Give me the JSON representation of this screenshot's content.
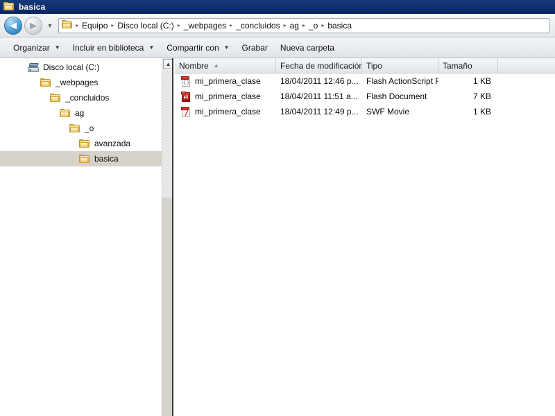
{
  "window": {
    "title": "basica",
    "title_icon": "folder-icon",
    "titlebar_color": "#0c2a66"
  },
  "navbar": {
    "back_icon": "back-arrow-icon",
    "back_glyph": "◀",
    "forward_icon": "forward-arrow-icon",
    "forward_glyph": "▶",
    "history_icon": "chevron-down-icon",
    "history_glyph": "▼",
    "address_icon": "folder-icon",
    "separator_glyph": "▸",
    "breadcrumbs": [
      "Equipo",
      "Disco local (C:)",
      "_webpages",
      "_concluidos",
      "ag",
      "_o",
      "basica"
    ]
  },
  "toolbar": {
    "items": [
      {
        "label": "Organizar",
        "has_caret": true
      },
      {
        "label": "Incluir en biblioteca",
        "has_caret": true
      },
      {
        "label": "Compartir con",
        "has_caret": true
      },
      {
        "label": "Grabar",
        "has_caret": false
      },
      {
        "label": "Nueva carpeta",
        "has_caret": false
      }
    ],
    "caret_glyph": "▼"
  },
  "tree": {
    "scroll_up_glyph": "▲",
    "items": [
      {
        "label": "Disco local (C:)",
        "icon": "hard-drive-icon",
        "indent": 0,
        "selected": false
      },
      {
        "label": "_webpages",
        "icon": "folder-icon",
        "indent": 1,
        "selected": false
      },
      {
        "label": "_concluidos",
        "icon": "folder-icon",
        "indent": 2,
        "selected": false
      },
      {
        "label": "ag",
        "icon": "folder-icon",
        "indent": 3,
        "selected": false
      },
      {
        "label": "_o",
        "icon": "folder-icon",
        "indent": 4,
        "selected": false
      },
      {
        "label": "avanzada",
        "icon": "folder-icon",
        "indent": 5,
        "selected": false
      },
      {
        "label": "basica",
        "icon": "folder-icon",
        "indent": 5,
        "selected": true
      }
    ]
  },
  "file_list": {
    "columns": [
      {
        "label": "Nombre",
        "sorted": true,
        "sort_glyph": "▲"
      },
      {
        "label": "Fecha de modificación",
        "sorted": false,
        "sort_glyph": ""
      },
      {
        "label": "Tipo",
        "sorted": false,
        "sort_glyph": ""
      },
      {
        "label": "Tamaño",
        "sorted": false,
        "sort_glyph": ""
      }
    ],
    "rows": [
      {
        "name": "mi_primera_clase",
        "date": "18/04/2011 12:46 p...",
        "type": "Flash ActionScript File",
        "size": "1 KB",
        "icon": "actionscript-file-icon",
        "icon_glyph": "{}"
      },
      {
        "name": "mi_primera_clase",
        "date": "18/04/2011 11:51 a...",
        "type": "Flash Document",
        "size": "7 KB",
        "icon": "flash-document-icon",
        "icon_glyph": "Fl"
      },
      {
        "name": "mi_primera_clase",
        "date": "18/04/2011 12:49 p...",
        "type": "SWF Movie",
        "size": "1 KB",
        "icon": "swf-movie-icon",
        "icon_glyph": "/"
      }
    ]
  }
}
